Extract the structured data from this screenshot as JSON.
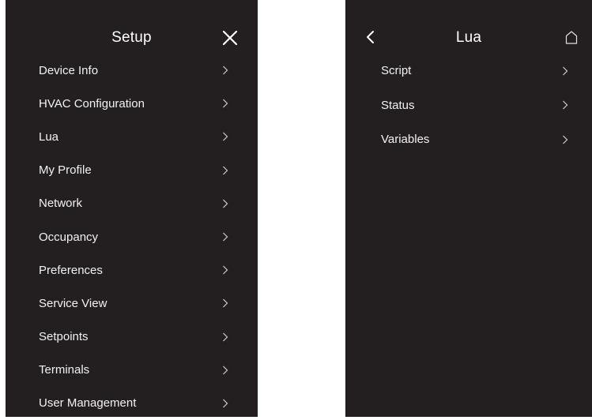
{
  "setup_panel": {
    "title": "Setup",
    "close_icon": "close-icon",
    "items": [
      {
        "label": "Device Info"
      },
      {
        "label": "HVAC Configuration"
      },
      {
        "label": "Lua"
      },
      {
        "label": "My Profile"
      },
      {
        "label": "Network"
      },
      {
        "label": "Occupancy"
      },
      {
        "label": "Preferences"
      },
      {
        "label": "Service View"
      },
      {
        "label": "Setpoints"
      },
      {
        "label": "Terminals"
      },
      {
        "label": "User Management"
      }
    ]
  },
  "lua_panel": {
    "title": "Lua",
    "back_icon": "chevron-left-icon",
    "home_icon": "home-icon",
    "items": [
      {
        "label": "Script"
      },
      {
        "label": "Status"
      },
      {
        "label": "Variables"
      }
    ]
  },
  "colors": {
    "panel_background": "#231f20",
    "page_background": "#ffffff",
    "text": "#ffffff"
  }
}
